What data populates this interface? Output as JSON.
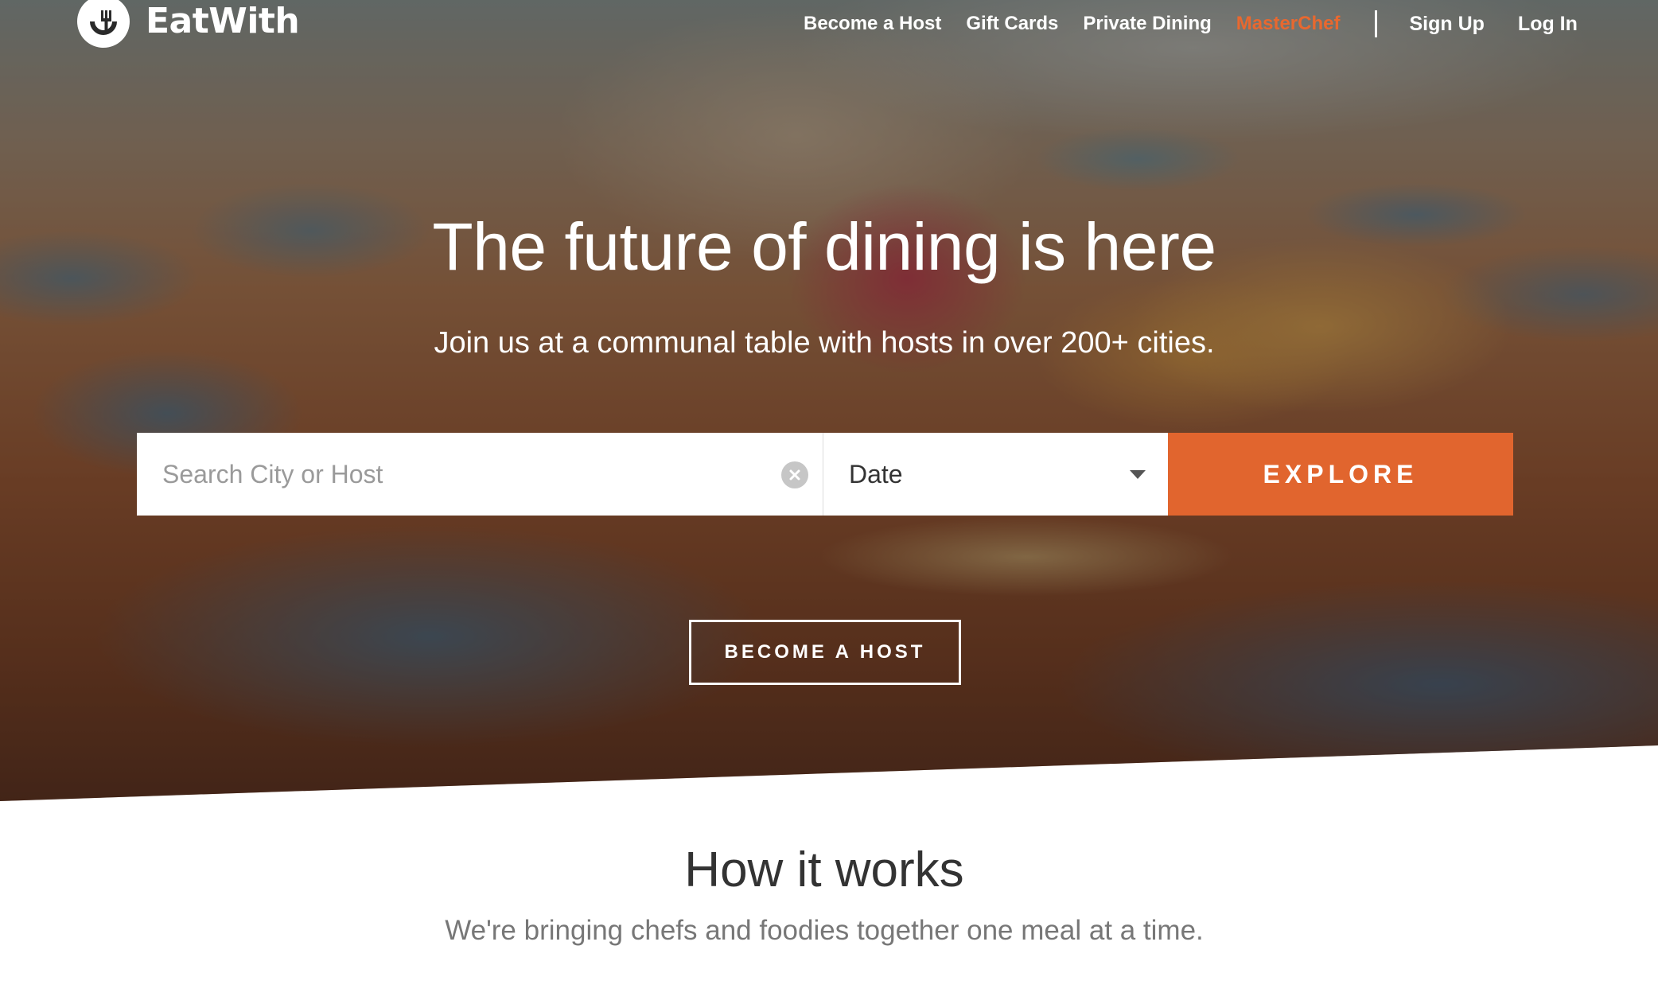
{
  "brand": {
    "name": "EatWith",
    "logo_icon": "fork-plate-icon"
  },
  "nav": {
    "links": [
      {
        "label": "Become a Host"
      },
      {
        "label": "Gift Cards"
      },
      {
        "label": "Private Dining"
      },
      {
        "label": "MasterChef"
      }
    ],
    "sign_up": "Sign Up",
    "log_in": "Log In",
    "accent_color": "#e8682f"
  },
  "hero": {
    "headline": "The future of dining is here",
    "subheadline": "Join us at a communal table with hosts in over 200+ cities.",
    "search": {
      "placeholder": "Search City or Host",
      "value": "",
      "clear_icon": "clear-circle-icon"
    },
    "date": {
      "label": "Date",
      "icon": "chevron-down-icon"
    },
    "explore_label": "EXPLORE",
    "explore_color": "#e1652e",
    "become_host_label": "BECOME A HOST"
  },
  "how_it_works": {
    "title": "How it works",
    "subtitle": "We're bringing chefs and foodies together one meal at a time."
  }
}
